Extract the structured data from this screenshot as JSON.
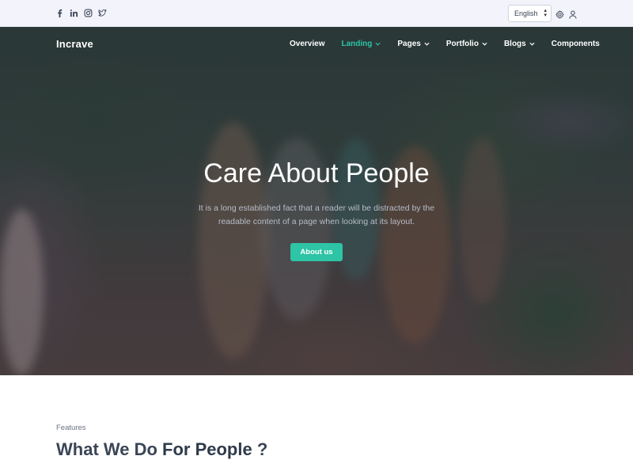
{
  "topbar": {
    "social": [
      {
        "icon": "facebook-icon"
      },
      {
        "icon": "linkedin-icon"
      },
      {
        "icon": "instagram-icon"
      },
      {
        "icon": "twitter-icon"
      }
    ],
    "language": "English",
    "settings_icon": "gear-icon",
    "account_icon": "user-icon"
  },
  "header": {
    "brand": "Incrave",
    "nav": [
      {
        "label": "Overview",
        "dropdown": false
      },
      {
        "label": "Landing",
        "dropdown": true,
        "active": true
      },
      {
        "label": "Pages",
        "dropdown": true
      },
      {
        "label": "Portfolio",
        "dropdown": true
      },
      {
        "label": "Blogs",
        "dropdown": true
      },
      {
        "label": "Components",
        "dropdown": false
      }
    ]
  },
  "hero": {
    "title": "Care About People",
    "subtitle": "It is a long established fact that a reader will be distracted by the readable content of a page when looking at its layout.",
    "button": "About us"
  },
  "features": {
    "label": "Features",
    "title_regular": "What We Do ",
    "title_bold": "For People",
    "title_end": " ?"
  },
  "colors": {
    "accent": "#2ec4a6",
    "topbar_bg": "#f2f3fb",
    "overlay": "#1e263c",
    "heading": "#3b4556"
  }
}
